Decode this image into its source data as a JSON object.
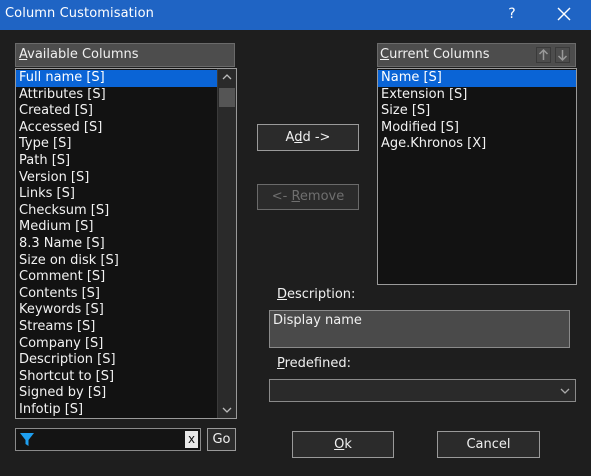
{
  "window": {
    "title": "Column Customisation",
    "help_glyph": "?",
    "close_glyph": "✕"
  },
  "available": {
    "header_first": "A",
    "header_rest": "vailable Columns",
    "selected_index": 0,
    "items": [
      "Full name [S]",
      "Attributes [S]",
      "Created [S]",
      "Accessed [S]",
      "Type [S]",
      "Path [S]",
      "Version [S]",
      "Links [S]",
      "Checksum [S]",
      "Medium [S]",
      "8.3 Name [S]",
      "Size on disk [S]",
      "Comment [S]",
      "Contents [S]",
      "Keywords [S]",
      "Streams [S]",
      "Company [S]",
      "Description [S]",
      "Shortcut to [S]",
      "Signed by [S]",
      "Infotip [S]"
    ]
  },
  "current": {
    "header_first": "C",
    "header_rest": "urrent Columns",
    "selected_index": 0,
    "items": [
      "Name [S]",
      "Extension [S]",
      "Size [S]",
      "Modified [S]",
      "Age.Khronos [X]"
    ]
  },
  "buttons": {
    "add_pre": "A",
    "add_ul": "d",
    "add_post": "d ->",
    "remove_pre": "<- ",
    "remove_ul": "R",
    "remove_post": "emove",
    "ok_ul": "O",
    "ok_post": "k",
    "cancel": "Cancel",
    "go": "Go",
    "clear_filter": "x"
  },
  "description": {
    "label_ul": "D",
    "label_rest": "escription:",
    "value": "Display name"
  },
  "predefined": {
    "label_ul": "P",
    "label_rest": "redefined:",
    "value": ""
  },
  "filter": {
    "value": ""
  },
  "colors": {
    "titlebar": "#1f64c4",
    "selection": "#0a64d6",
    "background": "#1e1e1e"
  }
}
